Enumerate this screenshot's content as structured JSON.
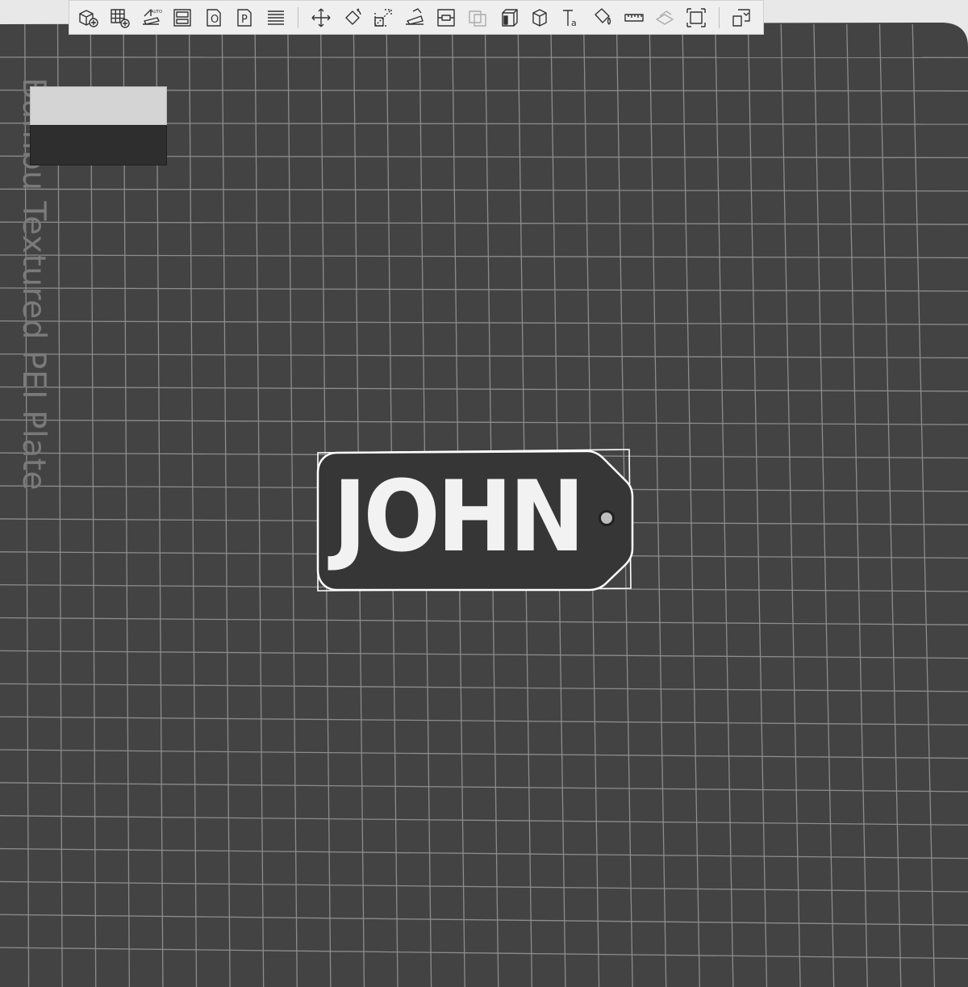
{
  "plate": {
    "label": "Bambu Textured PEI Plate",
    "background_color": "#434343",
    "grid_color": "#8c8c8c"
  },
  "filament_swatch": {
    "colors": [
      "#d4d4d4",
      "#2e2e2e"
    ]
  },
  "toolbar": {
    "groups": [
      [
        {
          "name": "add-object-button",
          "icon": "cube-plus-icon"
        },
        {
          "name": "add-plate-button",
          "icon": "grid-plus-icon"
        },
        {
          "name": "auto-orient-button",
          "icon": "auto-orient-icon"
        },
        {
          "name": "arrange-button",
          "icon": "arrange-icon"
        },
        {
          "name": "split-objects-button",
          "icon": "split-objects-icon"
        },
        {
          "name": "split-parts-button",
          "icon": "split-parts-icon"
        },
        {
          "name": "layers-editing-button",
          "icon": "layers-icon"
        }
      ],
      [
        {
          "name": "move-button",
          "icon": "move-icon"
        },
        {
          "name": "rotate-button",
          "icon": "rotate-icon"
        },
        {
          "name": "scale-button",
          "icon": "scale-icon"
        },
        {
          "name": "lay-on-face-button",
          "icon": "lay-on-face-icon"
        },
        {
          "name": "cut-button",
          "icon": "cut-icon"
        },
        {
          "name": "mesh-boolean-button",
          "icon": "boolean-icon",
          "disabled": true
        },
        {
          "name": "support-painting-button",
          "icon": "support-paint-icon"
        },
        {
          "name": "seam-painting-button",
          "icon": "seam-paint-icon"
        },
        {
          "name": "text-shape-button",
          "icon": "text-icon"
        },
        {
          "name": "color-painting-button",
          "icon": "paint-bucket-icon"
        },
        {
          "name": "measure-button",
          "icon": "ruler-icon"
        },
        {
          "name": "assemble-button",
          "icon": "assemble-icon",
          "disabled": true
        },
        {
          "name": "fit-view-button",
          "icon": "fit-view-icon"
        }
      ],
      [
        {
          "name": "view-switch-button",
          "icon": "view-switch-icon"
        }
      ]
    ]
  },
  "keychain": {
    "text": "JOHN",
    "body_color": "#363636",
    "text_color": "#f2f2f2",
    "outline_color": "#ffffff"
  }
}
